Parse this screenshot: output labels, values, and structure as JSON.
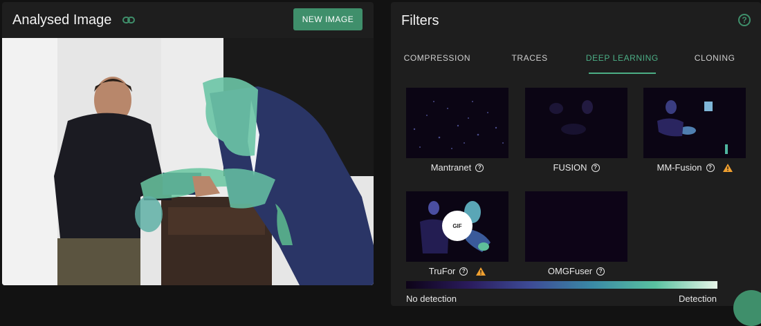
{
  "left_panel": {
    "title": "Analysed Image",
    "link_icon": "link-icon",
    "new_image_label": "NEW IMAGE"
  },
  "right_panel": {
    "title": "Filters",
    "help_icon": "question-circle-icon",
    "tabs": [
      {
        "label": "COMPRESSION",
        "active": false
      },
      {
        "label": "TRACES",
        "active": false
      },
      {
        "label": "DEEP LEARNING",
        "active": true
      },
      {
        "label": "CLONING",
        "active": false
      }
    ],
    "filters": [
      {
        "name": "Mantranet",
        "warning": false
      },
      {
        "name": "FUSION",
        "warning": false
      },
      {
        "name": "MM-Fusion",
        "warning": true
      },
      {
        "name": "TruFor",
        "warning": true,
        "badge": "GIF"
      },
      {
        "name": "OMGFuser",
        "warning": false
      }
    ],
    "scale": {
      "min_label": "No detection",
      "max_label": "Detection"
    }
  },
  "colors": {
    "accent": "#3f8f6b",
    "tab_active": "#4caf86",
    "warning": "#f0a030",
    "panel_bg": "#1e1e1e"
  }
}
